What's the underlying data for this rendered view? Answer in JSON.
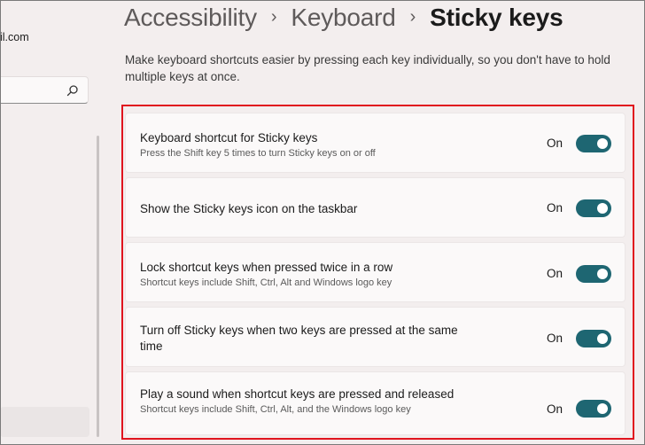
{
  "sidebar": {
    "account_email": "il.com",
    "search": {
      "placeholder": "",
      "icon": "search-icon"
    }
  },
  "breadcrumb": {
    "items": [
      "Accessibility",
      "Keyboard"
    ],
    "current": "Sticky keys",
    "separator": "›"
  },
  "page": {
    "description": "Make keyboard shortcuts easier by pressing each key individually, so you don't have to hold multiple keys at once."
  },
  "settings": [
    {
      "title": "Keyboard shortcut for Sticky keys",
      "subtitle": "Press the Shift key 5 times to turn Sticky keys on or off",
      "state_label": "On",
      "enabled": true
    },
    {
      "title": "Show the Sticky keys icon on the taskbar",
      "subtitle": "",
      "state_label": "On",
      "enabled": true
    },
    {
      "title": "Lock shortcut keys when pressed twice in a row",
      "subtitle": "Shortcut keys include Shift, Ctrl, Alt and Windows logo key",
      "state_label": "On",
      "enabled": true
    },
    {
      "title": "Turn off Sticky keys when two keys are pressed at the same time",
      "subtitle": "",
      "state_label": "On",
      "enabled": true
    },
    {
      "title": "Play a sound when shortcut keys are pressed and released",
      "subtitle": "Shortcut keys include Shift, Ctrl, Alt, and the Windows logo key",
      "state_label": "On",
      "enabled": true
    }
  ],
  "colors": {
    "accent": "#1e6672",
    "highlight_border": "#e0141e",
    "background": "#f3eeee",
    "card": "#fbf9f9"
  }
}
